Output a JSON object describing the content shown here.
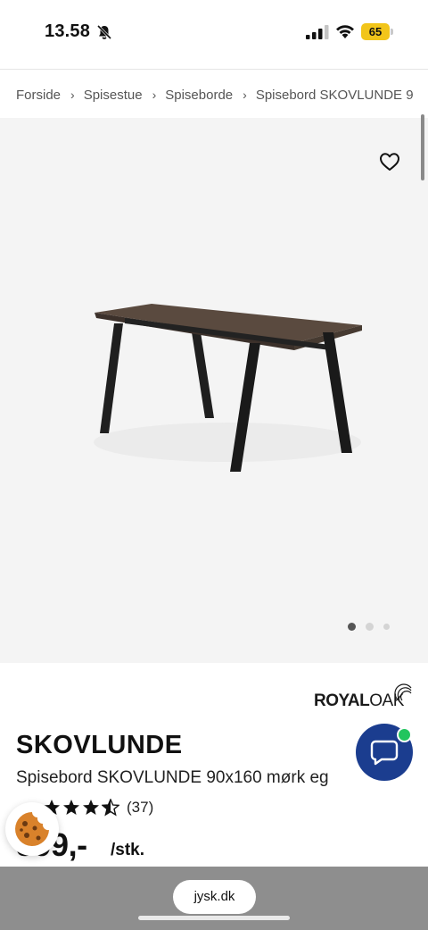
{
  "status_bar": {
    "time": "13.58",
    "battery_level": "65",
    "icons": [
      "bell-off-icon",
      "signal-icon",
      "wifi-icon",
      "battery-icon"
    ]
  },
  "breadcrumb": {
    "items": [
      "Forside",
      "Spisestue",
      "Spiseborde",
      "Spisebord SKOVLUNDE 9"
    ],
    "separator": "›"
  },
  "gallery": {
    "image_alt": "Spisebord SKOVLUNDE",
    "current_index": 1,
    "total_images": 3
  },
  "product": {
    "brand_bold": "ROYAL",
    "brand_light": "OAK",
    "name": "SKOVLUNDE",
    "description": "Spisebord SKOVLUNDE 90x160 mørk eg",
    "rating": 3.5,
    "rating_count": "(37)",
    "price": "899,-",
    "unit": "/stk."
  },
  "browser": {
    "url": "jysk.dk"
  },
  "colors": {
    "chat_button": "#1b3d8f",
    "chat_online": "#22c55e",
    "battery": "#f2c51a",
    "browser_bar": "#8e8e8e"
  }
}
